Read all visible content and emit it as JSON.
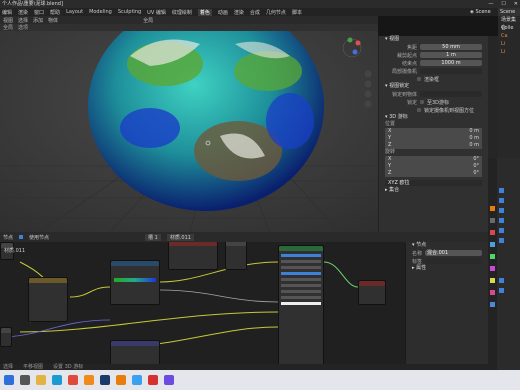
{
  "window": {
    "title": "个人作品\\重要\\泥球.blend]",
    "controls": [
      "—",
      "☐",
      "✕"
    ]
  },
  "menu": [
    "编辑",
    "渲染",
    "窗口",
    "帮助",
    "Layout",
    "Modeling",
    "Sculpting",
    "UV 编辑",
    "纹理绘制",
    "着色",
    "动画",
    "渲染",
    "合成",
    "几何节点",
    "脚本"
  ],
  "workspace": {
    "scene_label": "Scene"
  },
  "viewport": {
    "header": [
      "视图",
      "选择",
      "添加",
      "物体"
    ],
    "tool": [
      "全局",
      "选项"
    ],
    "shading_mode": "全局"
  },
  "npanel": {
    "view_title": "视图",
    "lens_label": "焦距",
    "lens_value": "50 mm",
    "clip_start_label": "裁剪起点",
    "clip_start_value": "1 m",
    "clip_end_label": "结束点",
    "clip_end_value": "1000 m",
    "local_camera_label": "局部摄像机",
    "render_region_label": "渲染框",
    "lock_title": "视图锁定",
    "lock_obj_label": "锁定到物体",
    "lock_label": "锁定",
    "lock_3d_cursor": "至3D游标",
    "lock_camera": "锁定摄像机到视图方位",
    "cursor_title": "3D 游标",
    "location_label": "位置",
    "loc_x": "0 m",
    "loc_y": "0 m",
    "loc_z": "0 m",
    "rotation_label": "旋转",
    "rot_x": "0°",
    "rot_y": "0°",
    "rot_z": "0°",
    "rot_mode": "XYZ 欧拉",
    "collections_title": "集合"
  },
  "outliner": {
    "title": "Scene",
    "items": [
      "场景集合",
      "Colle",
      "Ca",
      "Li",
      "Li"
    ]
  },
  "nodebar": {
    "items": [
      "节点",
      "使用节点",
      "槽 1",
      "材质.011"
    ]
  },
  "node_sidebar": {
    "section": "节点",
    "name_label": "名称",
    "name_value": "混合.001",
    "label_label": "标签",
    "props_title": "属性"
  },
  "material_name": "材质.011",
  "status": {
    "left": "选择",
    "center": "平移视图",
    "right": "设置 3D 游标"
  },
  "taskbar": {
    "icons": [
      {
        "name": "windows-icon",
        "color": "#2f6fdc"
      },
      {
        "name": "search-icon",
        "color": "#555555"
      },
      {
        "name": "explorer-icon",
        "color": "#e3b240"
      },
      {
        "name": "edge-icon",
        "color": "#1a9bd1"
      },
      {
        "name": "chrome-icon",
        "color": "#e04a3a"
      },
      {
        "name": "firefox-icon",
        "color": "#f08a1c"
      },
      {
        "name": "photoshop-icon",
        "color": "#1a3a6a"
      },
      {
        "name": "blender-icon",
        "color": "#e87d0d"
      },
      {
        "name": "qq-icon",
        "color": "#3aa0f0"
      },
      {
        "name": "wps-icon",
        "color": "#d63030"
      },
      {
        "name": "app-icon",
        "color": "#6c4ce0"
      }
    ]
  }
}
